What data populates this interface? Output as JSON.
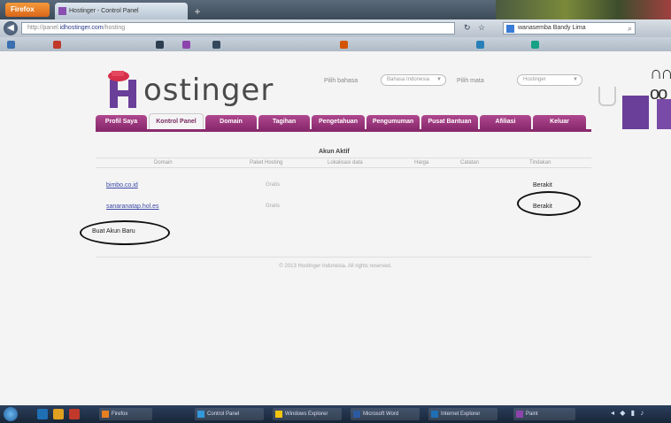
{
  "browser": {
    "menu_label": "Firefox",
    "tab_title": "Hostinger - Control Panel",
    "url_prefix": "http://panel.",
    "url_domain": "idhostinger.com",
    "url_suffix": "/hosting",
    "search_text": "wanasemba Bandy Lima"
  },
  "header": {
    "logo_text": "ostinger",
    "language_label": "Pilih bahasa",
    "language_value": "Bahasa Indonesia",
    "currency_label": "Pilih mata",
    "currency_value": "Hostinger"
  },
  "tabs": [
    {
      "label": "Profil Saya"
    },
    {
      "label": "Kontrol Panel"
    },
    {
      "label": "Domain"
    },
    {
      "label": "Tagihan"
    },
    {
      "label": "Pengetahuan"
    },
    {
      "label": "Pengumuman"
    },
    {
      "label": "Pusat Bantuan"
    },
    {
      "label": "Afiliasi"
    },
    {
      "label": "Keluar"
    }
  ],
  "accounts": {
    "title": "Akun Aktif",
    "columns": [
      "Domain",
      "Paket Hosting",
      "Lokalisasi data",
      "Harga",
      "Catatan",
      "Tindakan"
    ],
    "rows": [
      {
        "domain": "bimbo.co.id",
        "package": "Gratis",
        "status": "Berakit"
      },
      {
        "domain": "sanaranatap.hol.es",
        "package": "Gratis",
        "status": "Berakit"
      }
    ],
    "create_label": "Buat Akun Baru"
  },
  "footer": {
    "copyright": "© 2013 Hostinger Indonesia. All rights reserved."
  },
  "taskbar": {
    "items": [
      "Firefox",
      "Control Panel",
      "Windows Explorer",
      "Microsoft Word",
      "Internet Explorer",
      "Paint"
    ]
  }
}
